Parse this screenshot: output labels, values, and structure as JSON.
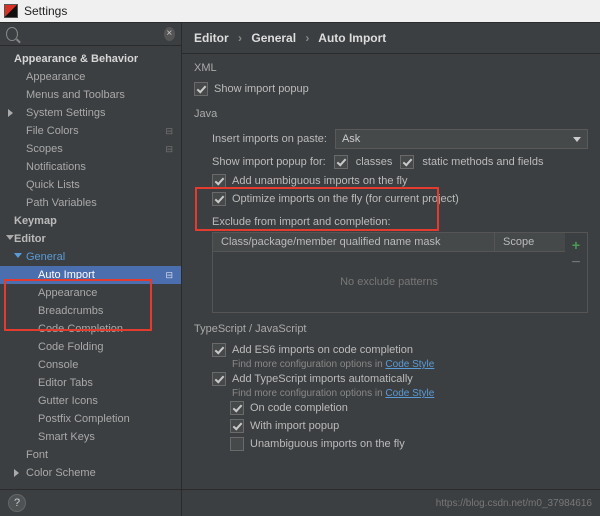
{
  "window": {
    "title": "Settings"
  },
  "search": {
    "placeholder": ""
  },
  "sidebar": {
    "section1": {
      "title": "Appearance & Behavior"
    },
    "items1": [
      {
        "label": "Appearance"
      },
      {
        "label": "Menus and Toolbars"
      },
      {
        "label": "System Settings",
        "expandable": true
      },
      {
        "label": "File Colors",
        "overridable": true
      },
      {
        "label": "Scopes",
        "overridable": true
      },
      {
        "label": "Notifications"
      },
      {
        "label": "Quick Lists"
      },
      {
        "label": "Path Variables"
      }
    ],
    "keymap": {
      "label": "Keymap"
    },
    "editor": {
      "label": "Editor"
    },
    "general": {
      "label": "General"
    },
    "auto_import": {
      "label": "Auto Import",
      "overridable": true
    },
    "items2": [
      {
        "label": "Appearance"
      },
      {
        "label": "Breadcrumbs"
      },
      {
        "label": "Code Completion"
      },
      {
        "label": "Code Folding"
      },
      {
        "label": "Console"
      },
      {
        "label": "Editor Tabs"
      },
      {
        "label": "Gutter Icons"
      },
      {
        "label": "Postfix Completion"
      },
      {
        "label": "Smart Keys"
      }
    ],
    "font": {
      "label": "Font"
    },
    "color_scheme": {
      "label": "Color Scheme"
    }
  },
  "breadcrumb": {
    "a": "Editor",
    "b": "General",
    "c": "Auto Import"
  },
  "xml": {
    "title": "XML",
    "show_popup": "Show import popup"
  },
  "java": {
    "title": "Java",
    "insert_label": "Insert imports on paste:",
    "insert_value": "Ask",
    "popup_label": "Show import popup for:",
    "classes_cb": "classes",
    "static_cb": "static methods and fields",
    "add_unamb": "Add unambiguous imports on the fly",
    "optimize": "Optimize imports on the fly (for current project)",
    "exclude_label": "Exclude from import and completion:",
    "col1": "Class/package/member qualified name mask",
    "col2": "Scope",
    "empty": "No exclude patterns"
  },
  "ts": {
    "title": "TypeScript / JavaScript",
    "add_es6": "Add ES6 imports on code completion",
    "hint1a": "Find more configuration options in ",
    "hint1b": "Code Style",
    "add_ts": "Add TypeScript imports automatically",
    "on_cc": "On code completion",
    "with_popup": "With import popup",
    "unamb": "Unambiguous imports on the fly"
  },
  "watermark": "https://blog.csdn.net/m0_37984616"
}
